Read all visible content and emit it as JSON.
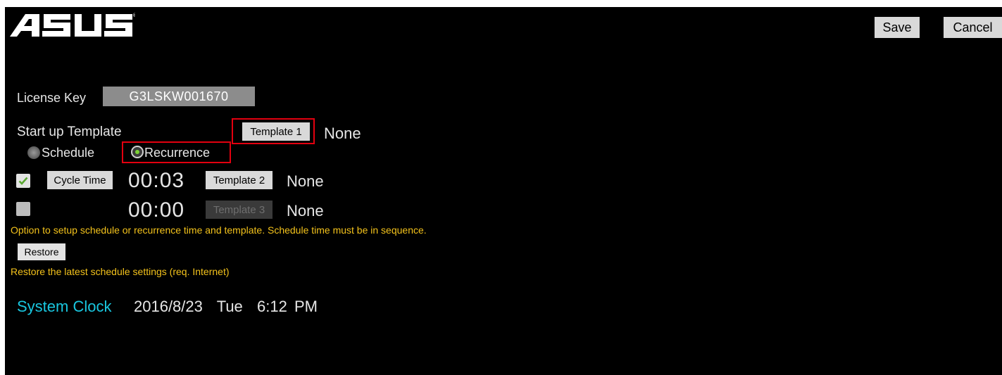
{
  "header": {
    "brand": "ASUS",
    "save_label": "Save",
    "cancel_label": "Cancel"
  },
  "license": {
    "label": "License Key",
    "value": "G3LSKW001670"
  },
  "startup": {
    "label": "Start up Template",
    "template_button": "Template 1",
    "template_value": "None"
  },
  "mode": {
    "options": [
      "Schedule",
      "Recurrence"
    ],
    "selected": "Recurrence"
  },
  "rows": [
    {
      "checked": true,
      "cycle_button": "Cycle Time",
      "time": "00:03",
      "template_button": "Template 2",
      "template_enabled": true,
      "template_value": "None"
    },
    {
      "checked": false,
      "time": "00:00",
      "template_button": "Template 3",
      "template_enabled": false,
      "template_value": "None"
    }
  ],
  "notes": {
    "option_hint": "Option to setup schedule or recurrence time and template. Schedule time must be in sequence.",
    "restore_label": "Restore",
    "restore_hint": "Restore the latest schedule settings (req. Internet)"
  },
  "clock": {
    "label": "System Clock",
    "value": "2016/8/23  Tue  6:12 PM"
  },
  "colors": {
    "background": "#000000",
    "highlight_box": "#e3000f",
    "hint_text": "#f3c21b",
    "clock_label": "#19c7e0",
    "radio_selected_dot": "#7cd235",
    "checkmark": "#5aa832"
  }
}
